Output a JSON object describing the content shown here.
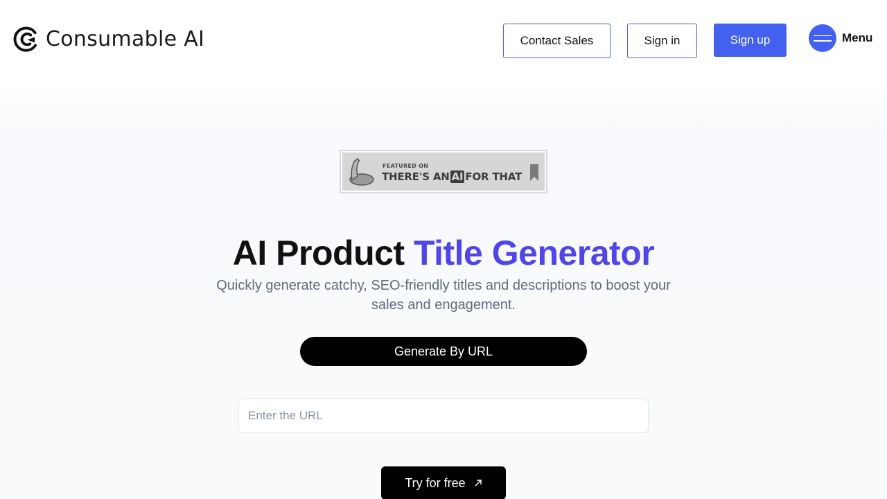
{
  "header": {
    "logo_text": "Consumable AI",
    "contact_sales_label": "Contact Sales",
    "sign_in_label": "Sign in",
    "sign_up_label": "Sign up",
    "menu_label": "Menu"
  },
  "badge": {
    "small_text": "FEATURED ON",
    "text_before": "THERE'S AN",
    "ai_text": "AI",
    "text_after": "FOR THAT"
  },
  "hero": {
    "title_main": "AI Product ",
    "title_accent": "Title Generator",
    "subtitle": "Quickly generate catchy, SEO-friendly titles and descriptions to boost your sales and engagement.",
    "generate_label": "Generate By URL",
    "url_placeholder": "Enter the URL",
    "url_value": "",
    "try_label": "Try for free"
  },
  "colors": {
    "brand_blue": "#4361ee",
    "accent_purple": "#4f46e5",
    "subtitle_gray": "#5f6b7a"
  },
  "icons": [
    "consumable-logo-icon",
    "hamburger-icon",
    "arm-icon",
    "bookmark-icon",
    "arrow-up-right-icon"
  ]
}
